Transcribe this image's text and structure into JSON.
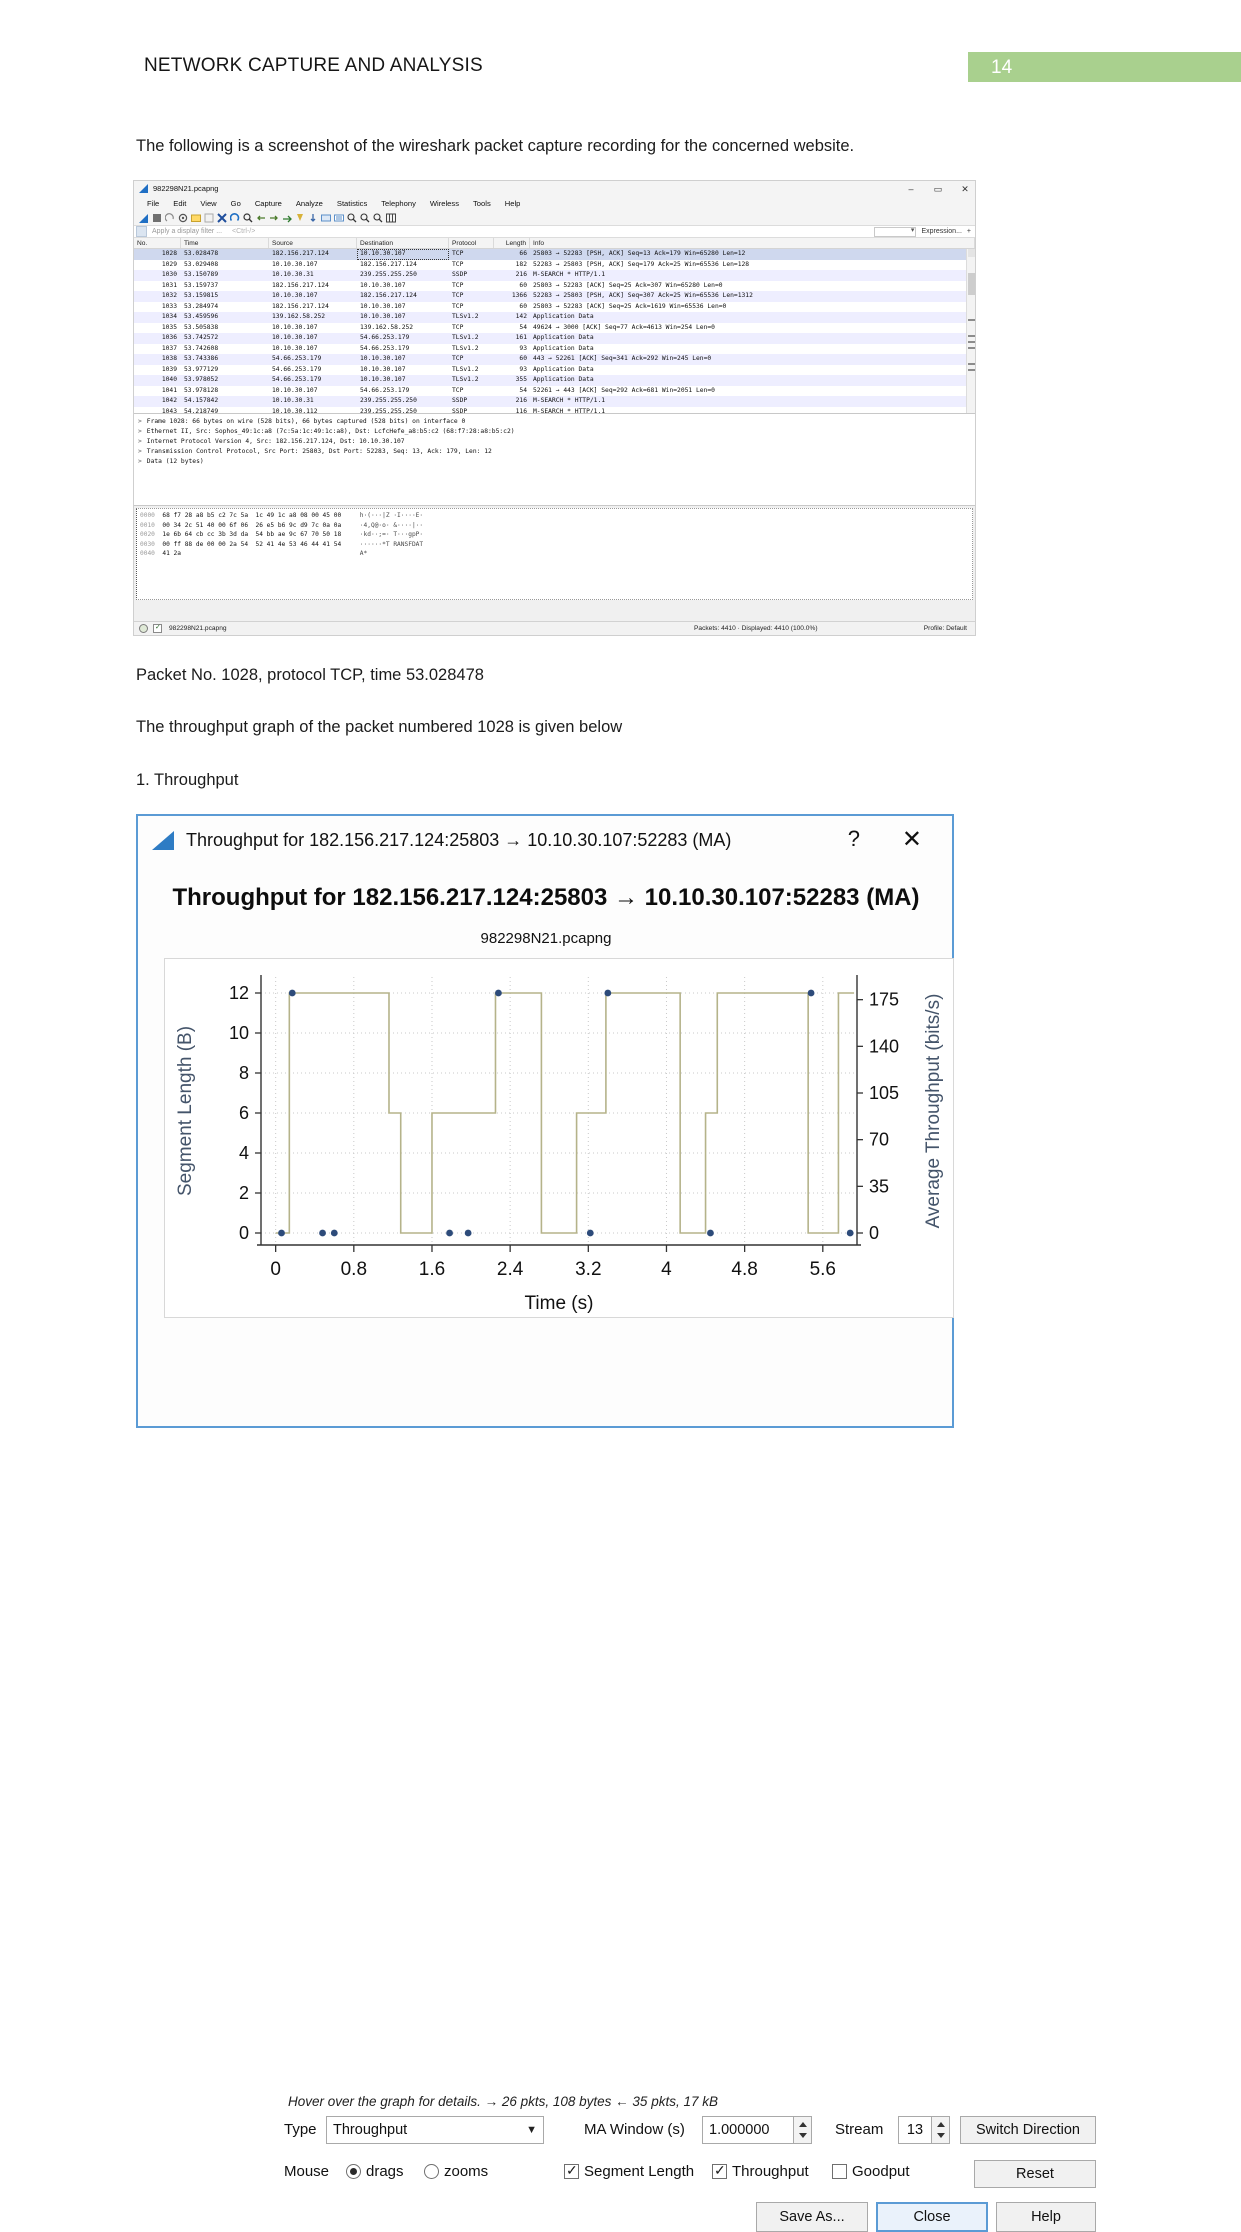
{
  "document": {
    "header_title": "NETWORK CAPTURE AND ANALYSIS",
    "page_number": "14",
    "page_badge_color": "#a9d08e",
    "intro_paragraph": "The following is a screenshot of the wireshark packet capture recording for the concerned website.",
    "packet_caption": "Packet No. 1028, protocol TCP, time 53.028478",
    "graph_caption": "The throughput graph of the packet numbered 1028 is given below",
    "section_heading": "1. Throughput"
  },
  "wireshark": {
    "title": "982298N21.pcapng",
    "window_buttons": [
      "–",
      "▭",
      "✕"
    ],
    "menus": [
      "File",
      "Edit",
      "View",
      "Go",
      "Capture",
      "Analyze",
      "Statistics",
      "Telephony",
      "Wireless",
      "Tools",
      "Help"
    ],
    "filter": {
      "placeholder": "Apply a display filter ...",
      "hint": "<Ctrl-/>",
      "expression_label": "Expression...",
      "plus_label": "+"
    },
    "columns": [
      "No.",
      "Time",
      "Source",
      "Destination",
      "Protocol",
      "Length",
      "Info"
    ],
    "rows": [
      {
        "no": "1028",
        "time": "53.028478",
        "src": "182.156.217.124",
        "dst": "10.10.30.107",
        "proto": "TCP",
        "len": "66",
        "info": "25803 → 52283 [PSH, ACK] Seq=13 Ack=179 Win=65280 Len=12",
        "selected": true
      },
      {
        "no": "1029",
        "time": "53.029408",
        "src": "10.10.30.107",
        "dst": "182.156.217.124",
        "proto": "TCP",
        "len": "182",
        "info": "52283 → 25803 [PSH, ACK] Seq=179 Ack=25 Win=65536 Len=128"
      },
      {
        "no": "1030",
        "time": "53.150789",
        "src": "10.10.30.31",
        "dst": "239.255.255.250",
        "proto": "SSDP",
        "len": "216",
        "info": "M-SEARCH * HTTP/1.1"
      },
      {
        "no": "1031",
        "time": "53.159737",
        "src": "182.156.217.124",
        "dst": "10.10.30.107",
        "proto": "TCP",
        "len": "60",
        "info": "25803 → 52283 [ACK] Seq=25 Ack=307 Win=65280 Len=0"
      },
      {
        "no": "1032",
        "time": "53.159815",
        "src": "10.10.30.107",
        "dst": "182.156.217.124",
        "proto": "TCP",
        "len": "1366",
        "info": "52283 → 25803 [PSH, ACK] Seq=307 Ack=25 Win=65536 Len=1312"
      },
      {
        "no": "1033",
        "time": "53.284974",
        "src": "182.156.217.124",
        "dst": "10.10.30.107",
        "proto": "TCP",
        "len": "60",
        "info": "25803 → 52283 [ACK] Seq=25 Ack=1619 Win=65536 Len=0"
      },
      {
        "no": "1034",
        "time": "53.459596",
        "src": "139.162.58.252",
        "dst": "10.10.30.107",
        "proto": "TLSv1.2",
        "len": "142",
        "info": "Application Data"
      },
      {
        "no": "1035",
        "time": "53.505838",
        "src": "10.10.30.107",
        "dst": "139.162.58.252",
        "proto": "TCP",
        "len": "54",
        "info": "49624 → 3000 [ACK] Seq=77 Ack=4613 Win=254 Len=0"
      },
      {
        "no": "1036",
        "time": "53.742572",
        "src": "10.10.30.107",
        "dst": "54.66.253.179",
        "proto": "TLSv1.2",
        "len": "161",
        "info": "Application Data"
      },
      {
        "no": "1037",
        "time": "53.742608",
        "src": "10.10.30.107",
        "dst": "54.66.253.179",
        "proto": "TLSv1.2",
        "len": "93",
        "info": "Application Data"
      },
      {
        "no": "1038",
        "time": "53.743386",
        "src": "54.66.253.179",
        "dst": "10.10.30.107",
        "proto": "TCP",
        "len": "60",
        "info": "443 → 52261 [ACK] Seq=341 Ack=292 Win=245 Len=0"
      },
      {
        "no": "1039",
        "time": "53.977129",
        "src": "54.66.253.179",
        "dst": "10.10.30.107",
        "proto": "TLSv1.2",
        "len": "93",
        "info": "Application Data"
      },
      {
        "no": "1040",
        "time": "53.978052",
        "src": "54.66.253.179",
        "dst": "10.10.30.107",
        "proto": "TLSv1.2",
        "len": "355",
        "info": "Application Data"
      },
      {
        "no": "1041",
        "time": "53.978128",
        "src": "10.10.30.107",
        "dst": "54.66.253.179",
        "proto": "TCP",
        "len": "54",
        "info": "52261 → 443 [ACK] Seq=292 Ack=681 Win=2051 Len=0"
      },
      {
        "no": "1042",
        "time": "54.157842",
        "src": "10.10.30.31",
        "dst": "239.255.255.250",
        "proto": "SSDP",
        "len": "216",
        "info": "M-SEARCH * HTTP/1.1"
      },
      {
        "no": "1043",
        "time": "54.218749",
        "src": "10.10.30.112",
        "dst": "239.255.255.250",
        "proto": "SSDP",
        "len": "116",
        "info": "M-SEARCH * HTTP/1.1"
      }
    ],
    "detail_lines": [
      "Frame 1028: 66 bytes on wire (528 bits), 66 bytes captured (528 bits) on interface 0",
      "Ethernet II, Src: Sophos_49:1c:a8 (7c:5a:1c:49:1c:a8), Dst: LcfcHefe_a8:b5:c2 (68:f7:28:a8:b5:c2)",
      "Internet Protocol Version 4, Src: 182.156.217.124, Dst: 10.10.30.107",
      "Transmission Control Protocol, Src Port: 25803, Dst Port: 52283, Seq: 13, Ack: 179, Len: 12",
      "Data (12 bytes)"
    ],
    "hex_lines": [
      {
        "offset": "0000",
        "bytes": "68 f7 28 a8 b5 c2 7c 5a  1c 49 1c a8 08 00 45 00",
        "ascii": "h·(···|Z ·I····E·"
      },
      {
        "offset": "0010",
        "bytes": "00 34 2c 51 40 00 6f 06  26 e5 b6 9c d9 7c 0a 0a",
        "ascii": "·4,Q@·o· &····|··"
      },
      {
        "offset": "0020",
        "bytes": "1e 6b 64 cb cc 3b 3d da  54 bb ae 9c 67 70 50 18",
        "ascii": "·kd··;=· T···gpP·"
      },
      {
        "offset": "0030",
        "bytes": "00 ff 88 de 00 00 2a 54  52 41 4e 53 46 44 41 54",
        "ascii": "······*T RANSFDAT"
      },
      {
        "offset": "0040",
        "bytes": "41 2a",
        "ascii": "A*"
      }
    ],
    "status": {
      "file": "982298N21.pcapng",
      "packets": "Packets: 4410 · Displayed: 4410 (100.0%)",
      "profile": "Profile: Default"
    }
  },
  "throughput_dialog": {
    "window_title": "Throughput for 182.156.217.124:25803 → 10.10.30.107:52283 (MA)",
    "help_glyph": "?",
    "close_glyph": "✕",
    "chart_title": "Throughput for 182.156.217.124:25803 → 10.10.30.107:52283 (MA)",
    "chart_subtitle": "982298N21.pcapng",
    "hover_note": "Hover over the graph for details. → 26 pkts, 108 bytes ← 35 pkts, 17 kB",
    "controls": {
      "type_label": "Type",
      "type_value": "Throughput",
      "ma_label": "MA Window (s)",
      "ma_value": "1.000000",
      "stream_label": "Stream",
      "stream_value": "13",
      "switch_direction_label": "Switch Direction",
      "mouse_label": "Mouse",
      "drags_label": "drags",
      "zooms_label": "zooms",
      "mouse_mode": "drags",
      "segment_length_label": "Segment Length",
      "segment_length_checked": true,
      "throughput_label": "Throughput",
      "throughput_checked": true,
      "goodput_label": "Goodput",
      "goodput_checked": false,
      "reset_label": "Reset",
      "save_as_label": "Save As...",
      "close_label": "Close",
      "help_label": "Help"
    }
  },
  "chart_data": {
    "type": "line",
    "title": "Throughput for 182.156.217.124:25803 → 10.10.30.107:52283 (MA)",
    "subtitle": "982298N21.pcapng",
    "xlabel": "Time (s)",
    "ylabel": "Segment Length (B)",
    "y2label": "Average Throughput (bits/s)",
    "xlim": [
      -0.15,
      5.95
    ],
    "ylim": [
      -0.6,
      12.8
    ],
    "y2lim": [
      -9,
      192
    ],
    "xticks": [
      "0",
      "0.8",
      "1.6",
      "2.4",
      "3.2",
      "4",
      "4.8",
      "5.6"
    ],
    "xtick_values": [
      0,
      0.8,
      1.6,
      2.4,
      3.2,
      4,
      4.8,
      5.6
    ],
    "yticks": [
      "0",
      "2",
      "4",
      "6",
      "8",
      "10",
      "12"
    ],
    "ytick_values": [
      0,
      2,
      4,
      6,
      8,
      10,
      12
    ],
    "y2ticks": [
      "0",
      "35",
      "70",
      "105",
      "140",
      "175"
    ],
    "y2tick_values": [
      0,
      35,
      70,
      105,
      140,
      175
    ],
    "grid": true,
    "series": [
      {
        "name": "Segment Length (B)",
        "type": "scatter",
        "color": "#2d4b7a",
        "points": [
          {
            "x": 0.06,
            "y": 0
          },
          {
            "x": 0.17,
            "y": 12
          },
          {
            "x": 0.48,
            "y": 0
          },
          {
            "x": 0.6,
            "y": 0
          },
          {
            "x": 1.78,
            "y": 0
          },
          {
            "x": 1.97,
            "y": 0
          },
          {
            "x": 2.28,
            "y": 12
          },
          {
            "x": 3.22,
            "y": 0
          },
          {
            "x": 3.4,
            "y": 12
          },
          {
            "x": 4.45,
            "y": 0
          },
          {
            "x": 5.48,
            "y": 12
          },
          {
            "x": 5.88,
            "y": 0
          }
        ]
      },
      {
        "name": "Average Throughput (bits/s)",
        "type": "step",
        "color": "#b5b38a",
        "points": [
          {
            "x": 0.0,
            "y": 0
          },
          {
            "x": 0.14,
            "y": 0
          },
          {
            "x": 0.14,
            "y": 12
          },
          {
            "x": 1.16,
            "y": 12
          },
          {
            "x": 1.16,
            "y": 6
          },
          {
            "x": 1.28,
            "y": 6
          },
          {
            "x": 1.28,
            "y": 0
          },
          {
            "x": 1.6,
            "y": 0
          },
          {
            "x": 1.6,
            "y": 6
          },
          {
            "x": 2.25,
            "y": 6
          },
          {
            "x": 2.25,
            "y": 12
          },
          {
            "x": 2.72,
            "y": 12
          },
          {
            "x": 2.72,
            "y": 0
          },
          {
            "x": 3.08,
            "y": 0
          },
          {
            "x": 3.08,
            "y": 6
          },
          {
            "x": 3.38,
            "y": 6
          },
          {
            "x": 3.38,
            "y": 12
          },
          {
            "x": 4.14,
            "y": 12
          },
          {
            "x": 4.14,
            "y": 0
          },
          {
            "x": 4.4,
            "y": 0
          },
          {
            "x": 4.4,
            "y": 6
          },
          {
            "x": 4.52,
            "y": 6
          },
          {
            "x": 4.52,
            "y": 12
          },
          {
            "x": 5.45,
            "y": 12
          },
          {
            "x": 5.45,
            "y": 0
          },
          {
            "x": 5.76,
            "y": 0
          },
          {
            "x": 5.76,
            "y": 12
          },
          {
            "x": 5.92,
            "y": 12
          }
        ]
      }
    ]
  }
}
